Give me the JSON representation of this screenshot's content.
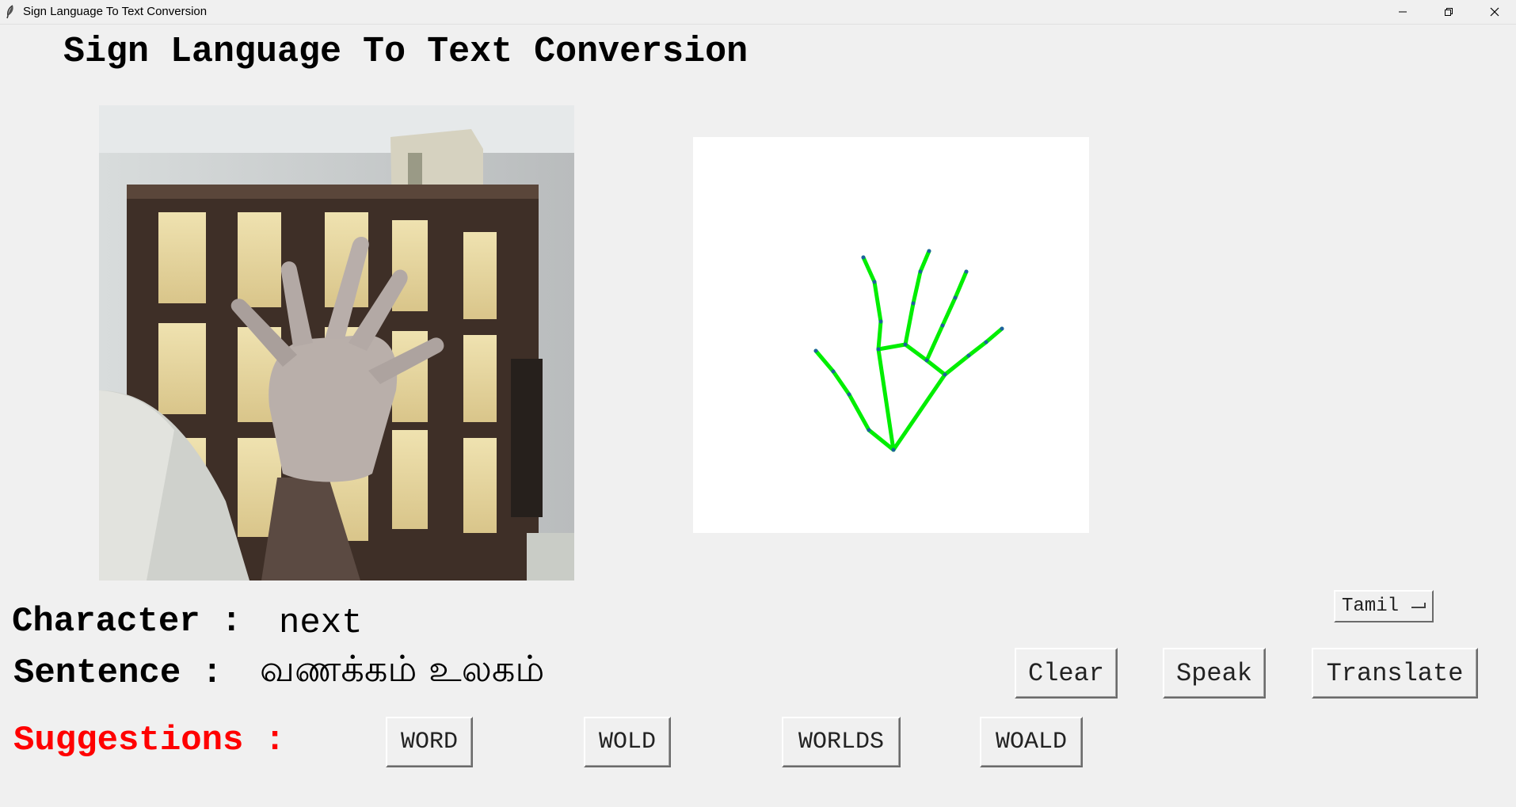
{
  "window": {
    "title": "Sign Language To Text Conversion",
    "app_icon": "feather-icon",
    "controls": [
      "minimize-icon",
      "restore-icon",
      "close-icon"
    ]
  },
  "heading": "Sign Language To Text Conversion",
  "character": {
    "label": "Character :",
    "value": "next"
  },
  "sentence": {
    "label": "Sentence :",
    "value": "வணக்கம் உலகம்"
  },
  "language_select": {
    "selected": "Tamil"
  },
  "actions": {
    "clear": "Clear",
    "speak": "Speak",
    "translate": "Translate"
  },
  "suggestions": {
    "label": "Suggestions :",
    "items": [
      "WORD",
      "WOLD",
      "WORLDS",
      "WOALD"
    ]
  },
  "colors": {
    "suggestions_label": "#ff0000",
    "skeleton_line": "#00ee00",
    "skeleton_joint": "#1f5fa0",
    "background": "#f0f0f0"
  }
}
